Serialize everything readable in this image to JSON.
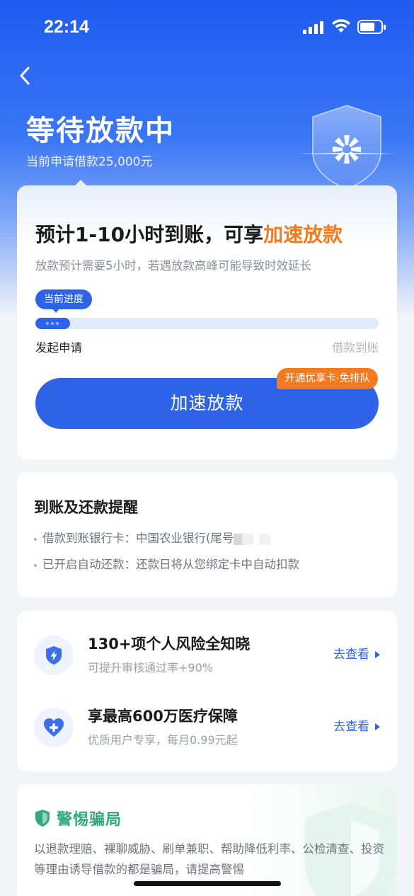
{
  "status_bar": {
    "time": "22:14"
  },
  "header": {
    "title": "等待放款中",
    "subtitle": "当前申请借款25,000元"
  },
  "main_card": {
    "headline_prefix": "预计1-10小时到账，可享",
    "headline_accent": "加速放款",
    "note": "放款预计需要5小时，若遇放款高峰可能导致时效延长",
    "progress_tag": "当前进度",
    "progress_fraction": 0.1,
    "step_start": "发起申请",
    "step_end": "借款到账",
    "cta_label": "加速放款",
    "cta_badge": "开通优享卡·免排队"
  },
  "reminder": {
    "title": "到账及还款提醒",
    "items": [
      "借款到账银行卡：中国农业银行(尾号",
      "已开启自动还款：还款日将从您绑定卡中自动扣款"
    ]
  },
  "services": [
    {
      "icon": "shield-lightning-icon",
      "title": "130+项个人风险全知晓",
      "desc": "可提升审核通过率+90%",
      "link": "去查看"
    },
    {
      "icon": "heart-plus-icon",
      "title": "享最高600万医疗保障",
      "desc": "优质用户专享，每月0.99元起",
      "link": "去查看"
    }
  ],
  "warning": {
    "title": "警惕骗局",
    "text": "以退款理赔、裸聊威胁、刷单兼职、帮助降低利率、公检清查、投资等理由诱导借款的都是骗局，请提高警惕"
  },
  "colors": {
    "primary": "#2e63e8",
    "accent": "#f47a20",
    "warning_green": "#2fa97a"
  }
}
